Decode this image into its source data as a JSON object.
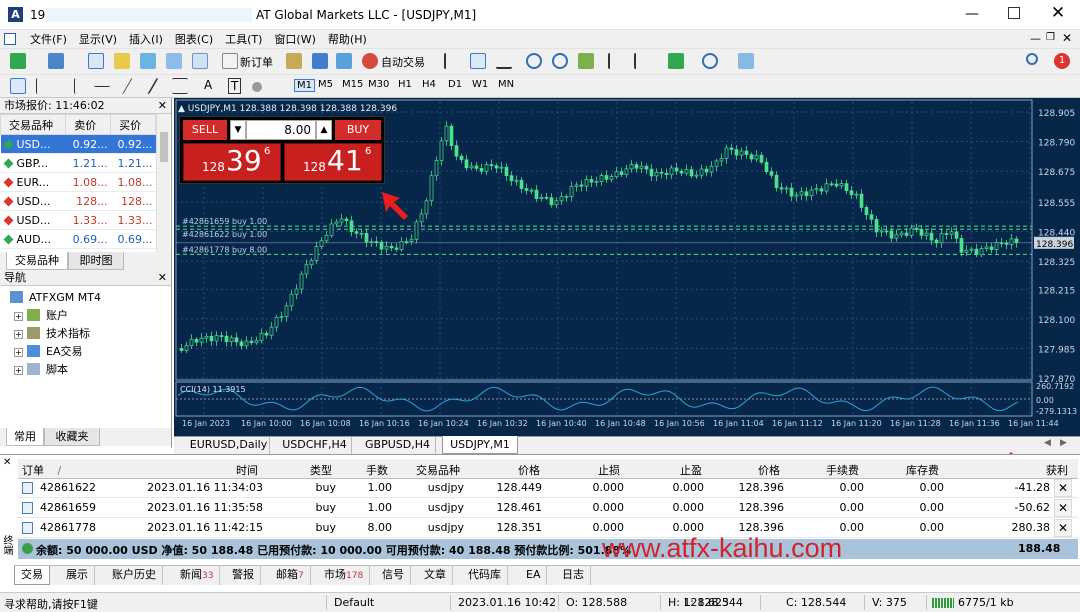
{
  "window": {
    "title_prefix": "19",
    "title": "AT Global Markets LLC - [USDJPY,M1]"
  },
  "menu": [
    "文件(F)",
    "显示(V)",
    "插入(I)",
    "图表(C)",
    "工具(T)",
    "窗口(W)",
    "帮助(H)"
  ],
  "toolbar": {
    "new_order": "新订单",
    "auto_trading": "自动交易"
  },
  "toolbar2": {
    "timeframes": [
      "M1",
      "M5",
      "M15",
      "M30",
      "H1",
      "H4",
      "D1",
      "W1",
      "MN"
    ],
    "text_tool": "A",
    "label_tool": "T"
  },
  "market_watch": {
    "title": "市场报价: 11:46:02",
    "columns": [
      "交易品种",
      "卖价",
      "买价"
    ],
    "rows": [
      {
        "symbol": "USD...",
        "bid": "0.92...",
        "ask": "0.92...",
        "dir": "up"
      },
      {
        "symbol": "GBP...",
        "bid": "1.21...",
        "ask": "1.21...",
        "dir": "up"
      },
      {
        "symbol": "EUR...",
        "bid": "1.08...",
        "ask": "1.08...",
        "dir": "down"
      },
      {
        "symbol": "USD...",
        "bid": "128...",
        "ask": "128...",
        "dir": "down"
      },
      {
        "symbol": "USD...",
        "bid": "1.33...",
        "ask": "1.33...",
        "dir": "down"
      },
      {
        "symbol": "AUD...",
        "bid": "0.69...",
        "ask": "0.69...",
        "dir": "up"
      }
    ],
    "tabs": [
      "交易品种",
      "即时图"
    ]
  },
  "navigator": {
    "title": "导航",
    "root": "ATFXGM MT4",
    "items": [
      "账户",
      "技术指标",
      "EA交易",
      "脚本"
    ],
    "tabs": [
      "常用",
      "收藏夹"
    ]
  },
  "chart": {
    "header": "USDJPY,M1  128.388 128.398 128.388 128.396",
    "one_click": {
      "sell": "SELL",
      "buy": "BUY",
      "volume": "8.00",
      "sell_big": "128",
      "sell_price": "39",
      "sell_sup": "6",
      "buy_big": "128",
      "buy_price": "41",
      "buy_sup": "6"
    },
    "order_lines": [
      "#42861659 buy 1.00",
      "#42861622 buy 1.00",
      "#42861778 buy 8.00"
    ],
    "indicator_label": "CCI(14) 11.3915",
    "price_labels": [
      "128.905",
      "128.790",
      "128.675",
      "128.555",
      "128.440",
      "128.325",
      "128.215",
      "128.100",
      "127.985",
      "127.870"
    ],
    "current_price": "128.396",
    "cci_labels": [
      "260.7192",
      "0.00",
      "-279.1313"
    ],
    "time_labels": [
      "16 Jan 2023",
      "16 Jan 10:00",
      "16 Jan 10:08",
      "16 Jan 10:16",
      "16 Jan 10:24",
      "16 Jan 10:32",
      "16 Jan 10:40",
      "16 Jan 10:48",
      "16 Jan 10:56",
      "16 Jan 11:04",
      "16 Jan 11:12",
      "16 Jan 11:20",
      "16 Jan 11:28",
      "16 Jan 11:36",
      "16 Jan 11:44"
    ],
    "tabs": [
      "EURUSD,Daily",
      "USDCHF,H4",
      "GBPUSD,H4",
      "USDJPY,M1"
    ],
    "colors": {
      "bg": "#06264a",
      "grid": "#2a4c74",
      "bull": "#4fe08a",
      "bear": "#4fe08a",
      "text": "#c8d8ea"
    }
  },
  "terminal": {
    "columns": [
      "订单",
      "时间",
      "类型",
      "手数",
      "交易品种",
      "价格",
      "止损",
      "止盈",
      "价格",
      "手续费",
      "库存费",
      "获利"
    ],
    "sort_mark": "/",
    "rows": [
      {
        "order": "42861622",
        "time": "2023.01.16 11:34:03",
        "type": "buy",
        "lots": "1.00",
        "symbol": "usdjpy",
        "price": "128.449",
        "sl": "0.000",
        "tp": "0.000",
        "cur": "128.396",
        "comm": "0.00",
        "swap": "0.00",
        "profit": "-41.28"
      },
      {
        "order": "42861659",
        "time": "2023.01.16 11:35:58",
        "type": "buy",
        "lots": "1.00",
        "symbol": "usdjpy",
        "price": "128.461",
        "sl": "0.000",
        "tp": "0.000",
        "cur": "128.396",
        "comm": "0.00",
        "swap": "0.00",
        "profit": "-50.62"
      },
      {
        "order": "42861778",
        "time": "2023.01.16 11:42:15",
        "type": "buy",
        "lots": "8.00",
        "symbol": "usdjpy",
        "price": "128.351",
        "sl": "0.000",
        "tp": "0.000",
        "cur": "128.396",
        "comm": "0.00",
        "swap": "0.00",
        "profit": "280.38"
      }
    ],
    "balance_line": "余额: 50 000.00 USD  净值: 50 188.48  已用预付款: 10 000.00  可用预付款: 40 188.48  预付款比例: 501.88%",
    "balance_total": "188.48",
    "watermark": "www.atfx-kaihu.com",
    "side_label": "终端",
    "tabs": [
      {
        "label": "交易",
        "badge": ""
      },
      {
        "label": "展示",
        "badge": ""
      },
      {
        "label": "账户历史",
        "badge": ""
      },
      {
        "label": "新闻",
        "badge": "33"
      },
      {
        "label": "警报",
        "badge": ""
      },
      {
        "label": "邮箱",
        "badge": "7"
      },
      {
        "label": "市场",
        "badge": "178"
      },
      {
        "label": "信号",
        "badge": ""
      },
      {
        "label": "文章",
        "badge": ""
      },
      {
        "label": "代码库",
        "badge": ""
      },
      {
        "label": "EA",
        "badge": ""
      },
      {
        "label": "日志",
        "badge": ""
      }
    ]
  },
  "statusbar": {
    "help": "寻求帮助,请按F1键",
    "profile": "Default",
    "datetime": "2023.01.16 10:42",
    "open": "O: 128.588",
    "high": "H: 128.623",
    "low": "L: 128.544",
    "close": "C: 128.544",
    "volume": "V: 375",
    "traffic": "6775/1 kb"
  }
}
